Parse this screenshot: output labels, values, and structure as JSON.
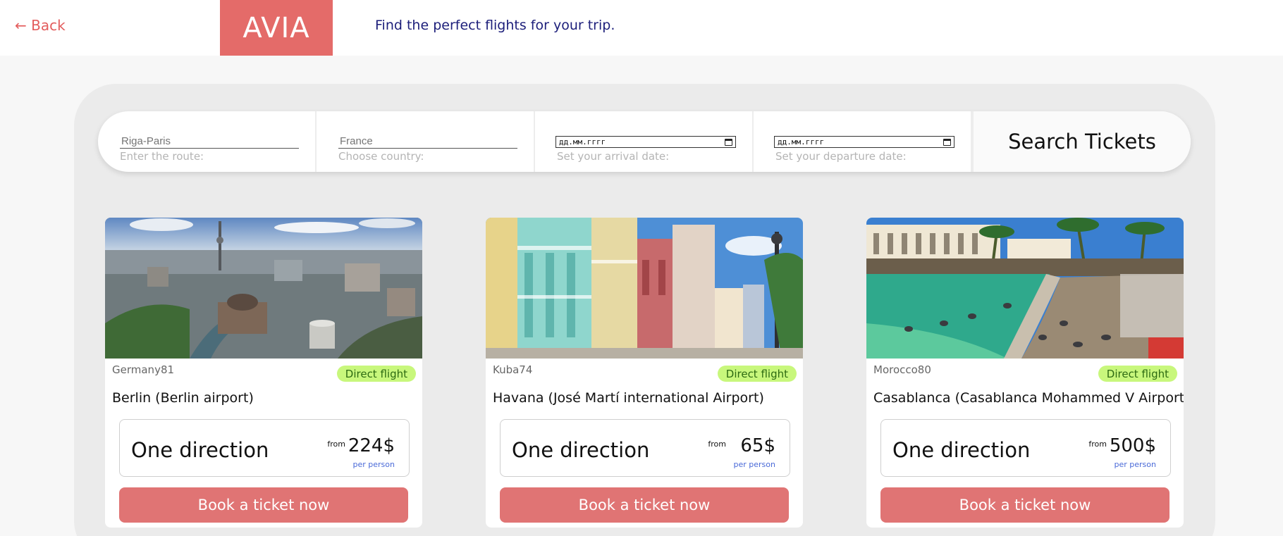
{
  "header": {
    "back_label": "← Back",
    "logo_text": "AVIA",
    "tagline": "Find the perfect flights for your trip."
  },
  "search": {
    "route": {
      "placeholder": "Riga-Paris",
      "hint": "Enter the route:"
    },
    "country": {
      "placeholder": "France",
      "hint": "Choose country:"
    },
    "arrival": {
      "value": "дд.мм.гггг",
      "hint": "Set your arrival date:"
    },
    "departure": {
      "value": "дд.мм.гггг",
      "hint": "Set your departure date:"
    },
    "button_label": "Search Tickets"
  },
  "cards": [
    {
      "code": "Germany81",
      "badge": "Direct flight",
      "city": "Berlin (Berlin airport)",
      "direction": "One direction",
      "from_label": "from",
      "price": "224$",
      "per_person": "per person",
      "button": "Book a ticket now"
    },
    {
      "code": "Kuba74",
      "badge": "Direct flight",
      "city": "Havana (José Martí international Airport)",
      "direction": "One direction",
      "from_label": "from",
      "price": "65$",
      "per_person": "per person",
      "button": "Book a ticket now"
    },
    {
      "code": "Morocco80",
      "badge": "Direct flight",
      "city": "Casablanca (Casablanca Mohammed V Airport)",
      "direction": "One direction",
      "from_label": "from",
      "price": "500$",
      "per_person": "per person",
      "button": "Book a ticket now"
    }
  ],
  "colors": {
    "accent": "#e46b69",
    "tagline": "#1c1e7a",
    "badge_bg": "#c8f77c",
    "book_button": "#e07474",
    "per_person": "#4a6ad8"
  }
}
